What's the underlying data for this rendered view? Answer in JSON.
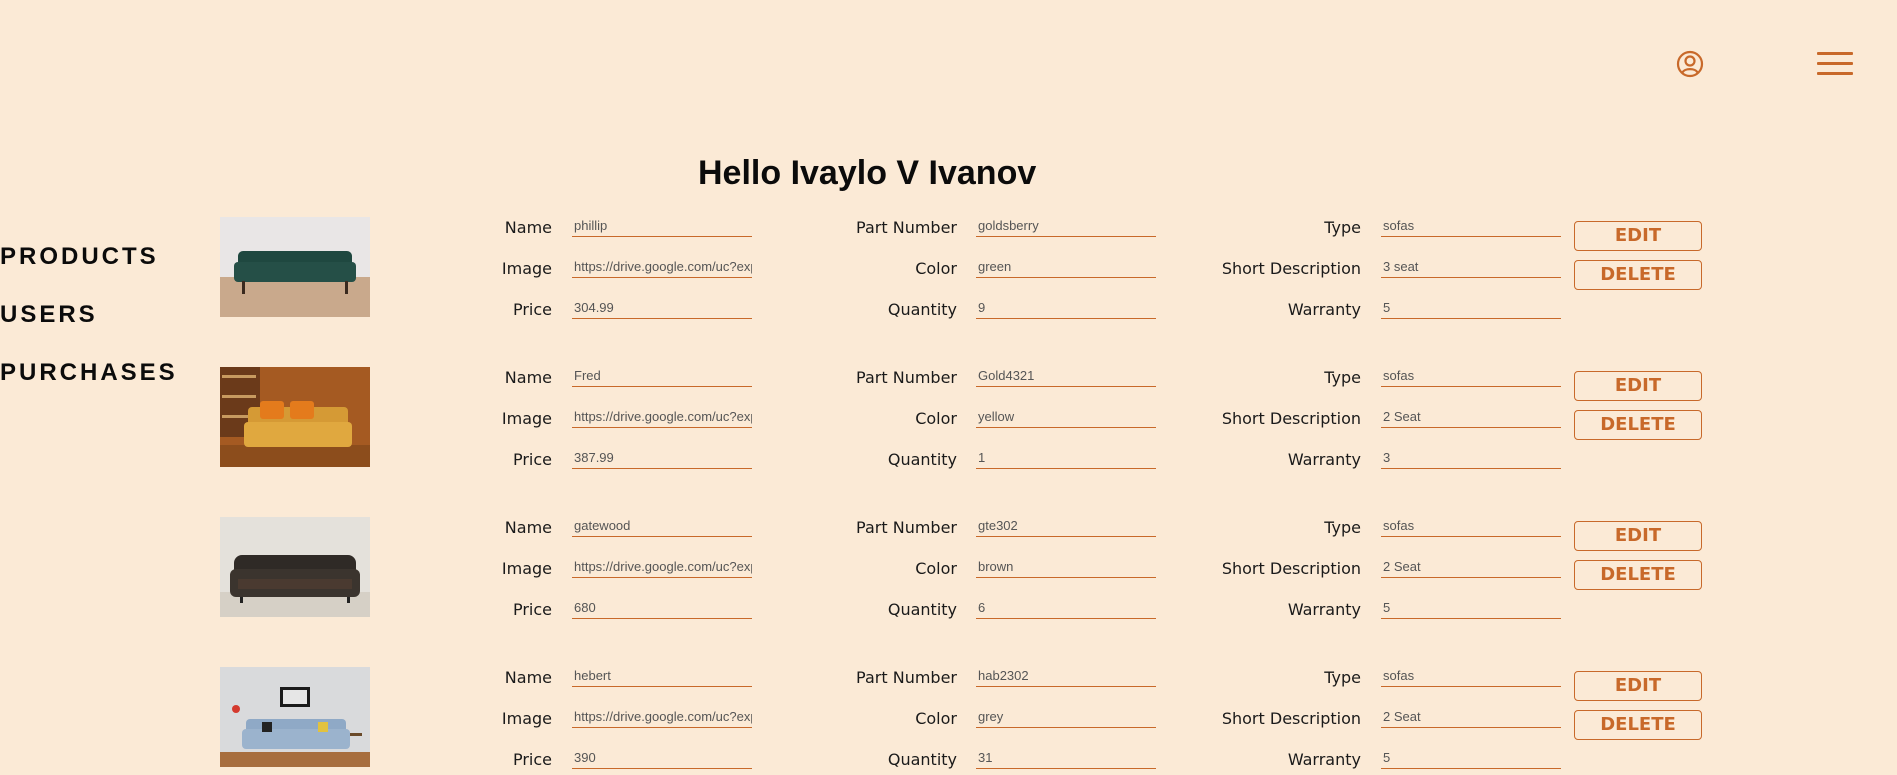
{
  "header": {
    "account_icon": "user-circle-icon",
    "menu_icon": "hamburger-menu-icon",
    "accent_color": "#c8692a",
    "background_color": "#fbead6"
  },
  "page_title": "Hello Ivaylo V Ivanov",
  "sidebar": {
    "items": [
      {
        "label": "PRODUCTS"
      },
      {
        "label": "USERS"
      },
      {
        "label": "PURCHASES"
      }
    ]
  },
  "field_labels": {
    "name": "Name",
    "image": "Image",
    "price": "Price",
    "part_number": "Part Number",
    "color": "Color",
    "quantity": "Quantity",
    "type": "Type",
    "short_description": "Short Description",
    "warranty": "Warranty"
  },
  "buttons": {
    "edit": "EDIT",
    "delete": "DELETE"
  },
  "products": [
    {
      "name": "phillip",
      "image": "https://drive.google.com/uc?export=view",
      "price": "304.99",
      "part_number": "goldsberry",
      "color": "green",
      "quantity": "9",
      "type": "sofas",
      "short_description": "3 seat",
      "warranty": "5"
    },
    {
      "name": "Fred",
      "image": "https://drive.google.com/uc?export=view",
      "price": "387.99",
      "part_number": "Gold4321",
      "color": "yellow",
      "quantity": "1",
      "type": "sofas",
      "short_description": "2 Seat",
      "warranty": "3"
    },
    {
      "name": "gatewood",
      "image": "https://drive.google.com/uc?export=view",
      "price": "680",
      "part_number": "gte302",
      "color": "brown",
      "quantity": "6",
      "type": "sofas",
      "short_description": "2 Seat",
      "warranty": "5"
    },
    {
      "name": "hebert",
      "image": "https://drive.google.com/uc?export=view",
      "price": "390",
      "part_number": "hab2302",
      "color": "grey",
      "quantity": "31",
      "type": "sofas",
      "short_description": "2 Seat",
      "warranty": "5"
    }
  ]
}
